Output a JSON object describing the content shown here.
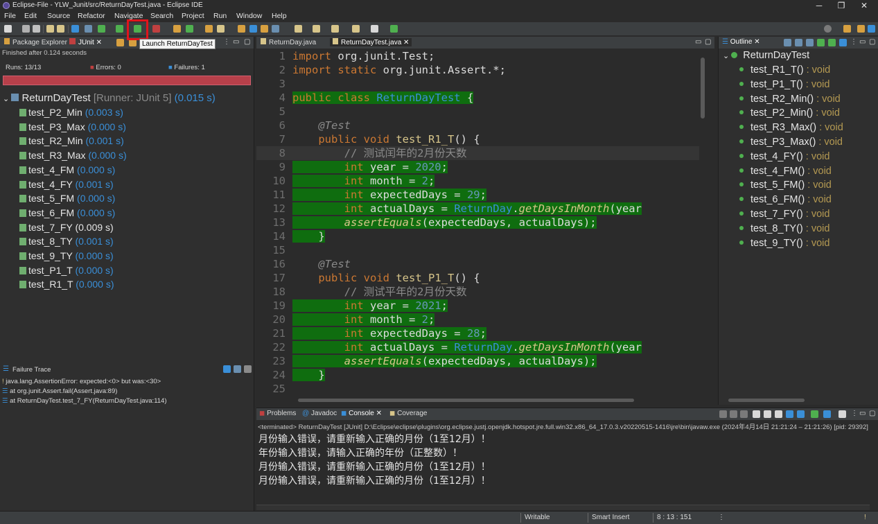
{
  "window": {
    "title": "Eclipse-File - YLW_Junit/src/ReturnDayTest.java - Eclipse IDE",
    "minimize": "─",
    "maximize": "❐",
    "close": "✕"
  },
  "menu": [
    "File",
    "Edit",
    "Source",
    "Refactor",
    "Navigate",
    "Search",
    "Project",
    "Run",
    "Window",
    "Help"
  ],
  "toolbar": {
    "tooltip": "Launch ReturnDayTest",
    "highlight_color": "#e0141c"
  },
  "left_panel": {
    "tabs": {
      "package_explorer": "Package Explorer",
      "junit": "JUnit"
    },
    "status_line": "Finished after 0.124 seconds",
    "runs": "Runs: 13/13",
    "errors": "Errors: 0",
    "failures": "Failures: 1",
    "progress_color": "#b7404a",
    "root": {
      "name": "ReturnDayTest",
      "runner": "[Runner: JUnit 5]",
      "time": "(0.015 s)"
    },
    "tests": [
      {
        "name": "test_P2_Min",
        "time": "(0.003 s)"
      },
      {
        "name": "test_P3_Max",
        "time": "(0.000 s)"
      },
      {
        "name": "test_R2_Min",
        "time": "(0.001 s)"
      },
      {
        "name": "test_R3_Max",
        "time": "(0.000 s)"
      },
      {
        "name": "test_4_FM",
        "time": "(0.000 s)"
      },
      {
        "name": "test_4_FY",
        "time": "(0.001 s)"
      },
      {
        "name": "test_5_FM",
        "time": "(0.000 s)"
      },
      {
        "name": "test_6_FM",
        "time": "(0.000 s)"
      },
      {
        "name": "test_7_FY",
        "time": "(0.009 s)",
        "failed": true
      },
      {
        "name": "test_8_TY",
        "time": "(0.001 s)"
      },
      {
        "name": "test_9_TY",
        "time": "(0.000 s)"
      },
      {
        "name": "test_P1_T",
        "time": "(0.000 s)"
      },
      {
        "name": "test_R1_T",
        "time": "(0.000 s)"
      }
    ],
    "failure_trace_title": "Failure Trace",
    "trace_lines": [
      "java.lang.AssertionError: expected:<0> but was:<30>",
      "at org.junit.Assert.fail(Assert.java:89)",
      "at ReturnDayTest.test_7_FY(ReturnDayTest.java:114)"
    ]
  },
  "editor": {
    "tabs": [
      "ReturnDay.java",
      "ReturnDayTest.java"
    ],
    "lines": [
      {
        "n": "1",
        "html": "<span class=\"kw\">import</span> org.junit.Test;"
      },
      {
        "n": "2",
        "html": "<span class=\"kw\">import static</span> org.junit.Assert.*;"
      },
      {
        "n": "3",
        "html": ""
      },
      {
        "n": "4",
        "html": "<span class=\"hl\"><span class=\"kw\">public class</span> <span class=\"cls\">ReturnDayTest</span> {</span>"
      },
      {
        "n": "5",
        "html": ""
      },
      {
        "n": "6",
        "html": "    <span class=\"ann\">@Test</span>"
      },
      {
        "n": "7",
        "html": "    <span class=\"kw\">public void</span> <span class=\"fn\">test_R1_T</span>() {"
      },
      {
        "n": "8",
        "html": "        <span class=\"cmt\">// 测试闰年的2月份天数</span>"
      },
      {
        "n": "9",
        "html": "<span class=\"hl\">        <span class=\"kw\">int</span> year = <span class=\"num\">2020</span>;</span>"
      },
      {
        "n": "10",
        "html": "<span class=\"hl\">        <span class=\"kw\">int</span> month = <span class=\"num\">2</span>;</span>"
      },
      {
        "n": "11",
        "html": "<span class=\"hl\">        <span class=\"kw\">int</span> expectedDays = <span class=\"num\">29</span>;</span>"
      },
      {
        "n": "12",
        "html": "<span class=\"hl\">        <span class=\"kw\">int</span> actualDays = <span class=\"cls\">ReturnDay</span>.<span class=\"mth\">getDaysInMonth</span>(year</span>"
      },
      {
        "n": "13",
        "html": "<span class=\"hl\">        <span class=\"mth\">assertEquals</span>(expectedDays, actualDays);</span>"
      },
      {
        "n": "14",
        "html": "<span class=\"hl\">    }</span>"
      },
      {
        "n": "15",
        "html": ""
      },
      {
        "n": "16",
        "html": "    <span class=\"ann\">@Test</span>"
      },
      {
        "n": "17",
        "html": "    <span class=\"kw\">public void</span> <span class=\"fn\">test_P1_T</span>() {"
      },
      {
        "n": "18",
        "html": "        <span class=\"cmt\">// 测试平年的2月份天数</span>"
      },
      {
        "n": "19",
        "html": "<span class=\"hl\">        <span class=\"kw\">int</span> year = <span class=\"num\">2021</span>;</span>"
      },
      {
        "n": "20",
        "html": "<span class=\"hl\">        <span class=\"kw\">int</span> month = <span class=\"num\">2</span>;</span>"
      },
      {
        "n": "21",
        "html": "<span class=\"hl\">        <span class=\"kw\">int</span> expectedDays = <span class=\"num\">28</span>;</span>"
      },
      {
        "n": "22",
        "html": "<span class=\"hl\">        <span class=\"kw\">int</span> actualDays = <span class=\"cls\">ReturnDay</span>.<span class=\"mth\">getDaysInMonth</span>(year</span>"
      },
      {
        "n": "23",
        "html": "<span class=\"hl\">        <span class=\"mth\">assertEquals</span>(expectedDays, actualDays);</span>"
      },
      {
        "n": "24",
        "html": "<span class=\"hl\">    }</span>"
      },
      {
        "n": "25",
        "html": ""
      }
    ]
  },
  "outline": {
    "title": "Outline",
    "class_name": "ReturnDayTest",
    "methods": [
      {
        "name": "test_R1_T()",
        "rtype": " : void"
      },
      {
        "name": "test_P1_T()",
        "rtype": " : void"
      },
      {
        "name": "test_R2_Min()",
        "rtype": " : void"
      },
      {
        "name": "test_P2_Min()",
        "rtype": " : void"
      },
      {
        "name": "test_R3_Max()",
        "rtype": " : void"
      },
      {
        "name": "test_P3_Max()",
        "rtype": " : void"
      },
      {
        "name": "test_4_FY()",
        "rtype": " : void"
      },
      {
        "name": "test_4_FM()",
        "rtype": " : void"
      },
      {
        "name": "test_5_FM()",
        "rtype": " : void"
      },
      {
        "name": "test_6_FM()",
        "rtype": " : void"
      },
      {
        "name": "test_7_FY()",
        "rtype": " : void"
      },
      {
        "name": "test_8_TY()",
        "rtype": " : void"
      },
      {
        "name": "test_9_TY()",
        "rtype": " : void"
      }
    ]
  },
  "console": {
    "tabs": [
      "Problems",
      "Javadoc",
      "Console",
      "Coverage"
    ],
    "terminated": "<terminated> ReturnDayTest [JUnit] D:\\Eclipse\\eclipse\\plugins\\org.eclipse.justj.openjdk.hotspot.jre.full.win32.x86_64_17.0.3.v20220515-1416\\jre\\bin\\javaw.exe  (2024年4月14日 21:21:24 – 21:21:26) [pid: 29392]",
    "lines": [
      "月份输入错误，请重新输入正确的月份（1至12月）！",
      "年份输入错误，请输入正确的年份（正整数）！",
      "月份输入错误，请重新输入正确的月份（1至12月）！",
      "月份输入错误，请重新输入正确的月份（1至12月）！"
    ]
  },
  "statusbar": {
    "writable": "Writable",
    "insert_mode": "Smart Insert",
    "position": "8 : 13 : 151"
  }
}
